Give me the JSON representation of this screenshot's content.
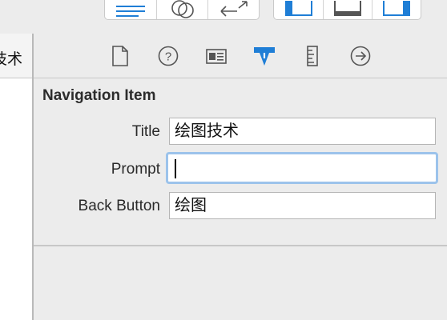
{
  "left_panel": {
    "visible_text": "技术"
  },
  "toolbar": {
    "editor_group": [
      "editor-standard-icon",
      "editor-assistant-icon",
      "editor-version-icon"
    ],
    "view_group": [
      "navigator-toggle-icon",
      "debug-area-toggle-icon",
      "utilities-toggle-icon"
    ],
    "accent_color": "#1f7ed6"
  },
  "inspector": {
    "tabs": [
      {
        "name": "file-inspector-icon"
      },
      {
        "name": "quick-help-icon"
      },
      {
        "name": "identity-inspector-icon"
      },
      {
        "name": "attributes-inspector-icon",
        "selected": true
      },
      {
        "name": "size-inspector-icon"
      },
      {
        "name": "connections-inspector-icon"
      }
    ],
    "section_title": "Navigation Item",
    "fields": [
      {
        "label": "Title",
        "value": "绘图技术"
      },
      {
        "label": "Prompt",
        "value": ""
      },
      {
        "label": "Back Button",
        "value": "绘图"
      }
    ],
    "focus_color": "#9cc3eb"
  }
}
